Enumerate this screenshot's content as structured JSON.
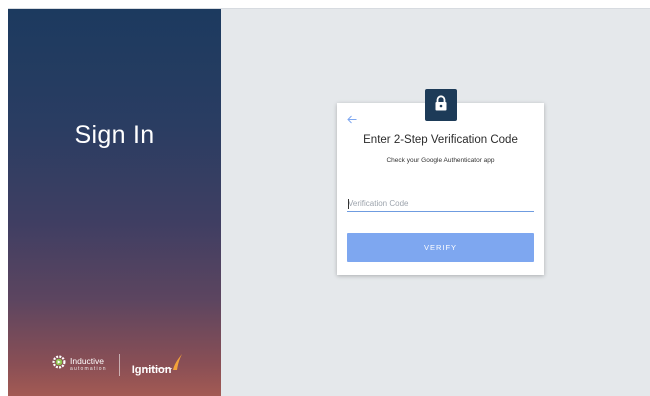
{
  "left_panel": {
    "title": "Sign In",
    "brand": {
      "ia_line1": "Inductive",
      "ia_line2": "automation",
      "ignition": "Ignition"
    }
  },
  "card": {
    "title": "Enter 2-Step Verification Code",
    "subtitle": "Check your Google Authenticator app",
    "code_input": {
      "value": "",
      "placeholder": "Verification Code"
    },
    "verify_label": "VERIFY"
  },
  "icons": {
    "lock": "lock-icon",
    "back": "arrow-left-icon",
    "ia_gear": "gear-icon",
    "ignition_flame": "flame-icon"
  },
  "colors": {
    "card_button": "#7ea7f0",
    "lock_badge": "#1d3b58",
    "input_underline": "#6f9ce0",
    "right_bg": "#e5e8eb",
    "back_arrow": "#7ea7f0",
    "ignition_flame": "#f2a23a",
    "ia_gear": "#8bc34a"
  }
}
